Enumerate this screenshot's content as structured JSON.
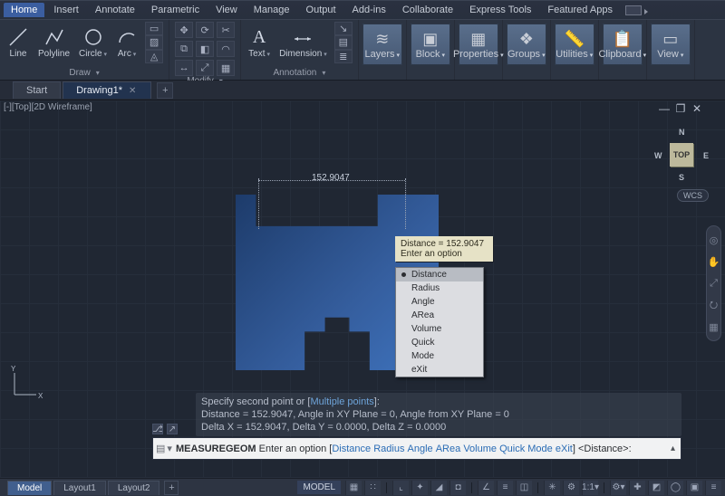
{
  "menu": {
    "tabs": [
      "Home",
      "Insert",
      "Annotate",
      "Parametric",
      "View",
      "Manage",
      "Output",
      "Add-ins",
      "Collaborate",
      "Express Tools",
      "Featured Apps"
    ],
    "active_index": 0
  },
  "ribbon": {
    "draw": {
      "title": "Draw",
      "items": [
        "Line",
        "Polyline",
        "Circle",
        "Arc"
      ]
    },
    "modify": {
      "title": "Modify"
    },
    "annotation": {
      "title": "Annotation",
      "items": [
        "Text",
        "Dimension"
      ]
    },
    "simple_panels": [
      {
        "label": "Layers",
        "icon": "layers"
      },
      {
        "label": "Block",
        "icon": "block"
      },
      {
        "label": "Properties",
        "icon": "properties"
      },
      {
        "label": "Groups",
        "icon": "groups"
      },
      {
        "label": "Utilities",
        "icon": "utilities"
      },
      {
        "label": "Clipboard",
        "icon": "clipboard"
      },
      {
        "label": "View",
        "icon": "view"
      }
    ]
  },
  "doc_tabs": {
    "tabs": [
      "Start",
      "Drawing1*"
    ],
    "active_index": 1
  },
  "viewport": {
    "label": "[-][Top][2D Wireframe]"
  },
  "viewcube": {
    "face": "TOP",
    "dirs": {
      "n": "N",
      "s": "S",
      "e": "E",
      "w": "W"
    },
    "wcs": "WCS"
  },
  "dimension": {
    "value": "152.9047"
  },
  "tooltip": {
    "line1": "Distance = 152.9047",
    "line2": "Enter an option"
  },
  "popup": {
    "items": [
      "Distance",
      "Radius",
      "Angle",
      "ARea",
      "Volume",
      "Quick",
      "Mode",
      "eXit"
    ],
    "selected_index": 0
  },
  "cmd_history": {
    "line1_a": "Specify second point or [",
    "line1_b": "Multiple points",
    "line1_c": "]:",
    "line2": "Distance = 152.9047,  Angle in XY Plane = 0,  Angle from XY Plane = 0",
    "line3": "Delta X = 152.9047,  Delta Y = 0.0000,  Delta Z = 0.0000"
  },
  "cmdline": {
    "cmd": "MEASUREGEOM",
    "prompt1": " Enter an option [",
    "opts": [
      "Distance",
      "Radius",
      "Angle",
      "ARea",
      "Volume",
      "Quick",
      "Mode",
      "eXit"
    ],
    "prompt2": "] <",
    "default": "Distance",
    "prompt3": ">:"
  },
  "layout_tabs": {
    "tabs": [
      "Model",
      "Layout1",
      "Layout2"
    ],
    "active_index": 0
  },
  "statusbar": {
    "model": "MODEL",
    "scale": "1:1"
  },
  "colors": {
    "accent": "#3b5ea0",
    "bracket": "#2a6cb5"
  }
}
